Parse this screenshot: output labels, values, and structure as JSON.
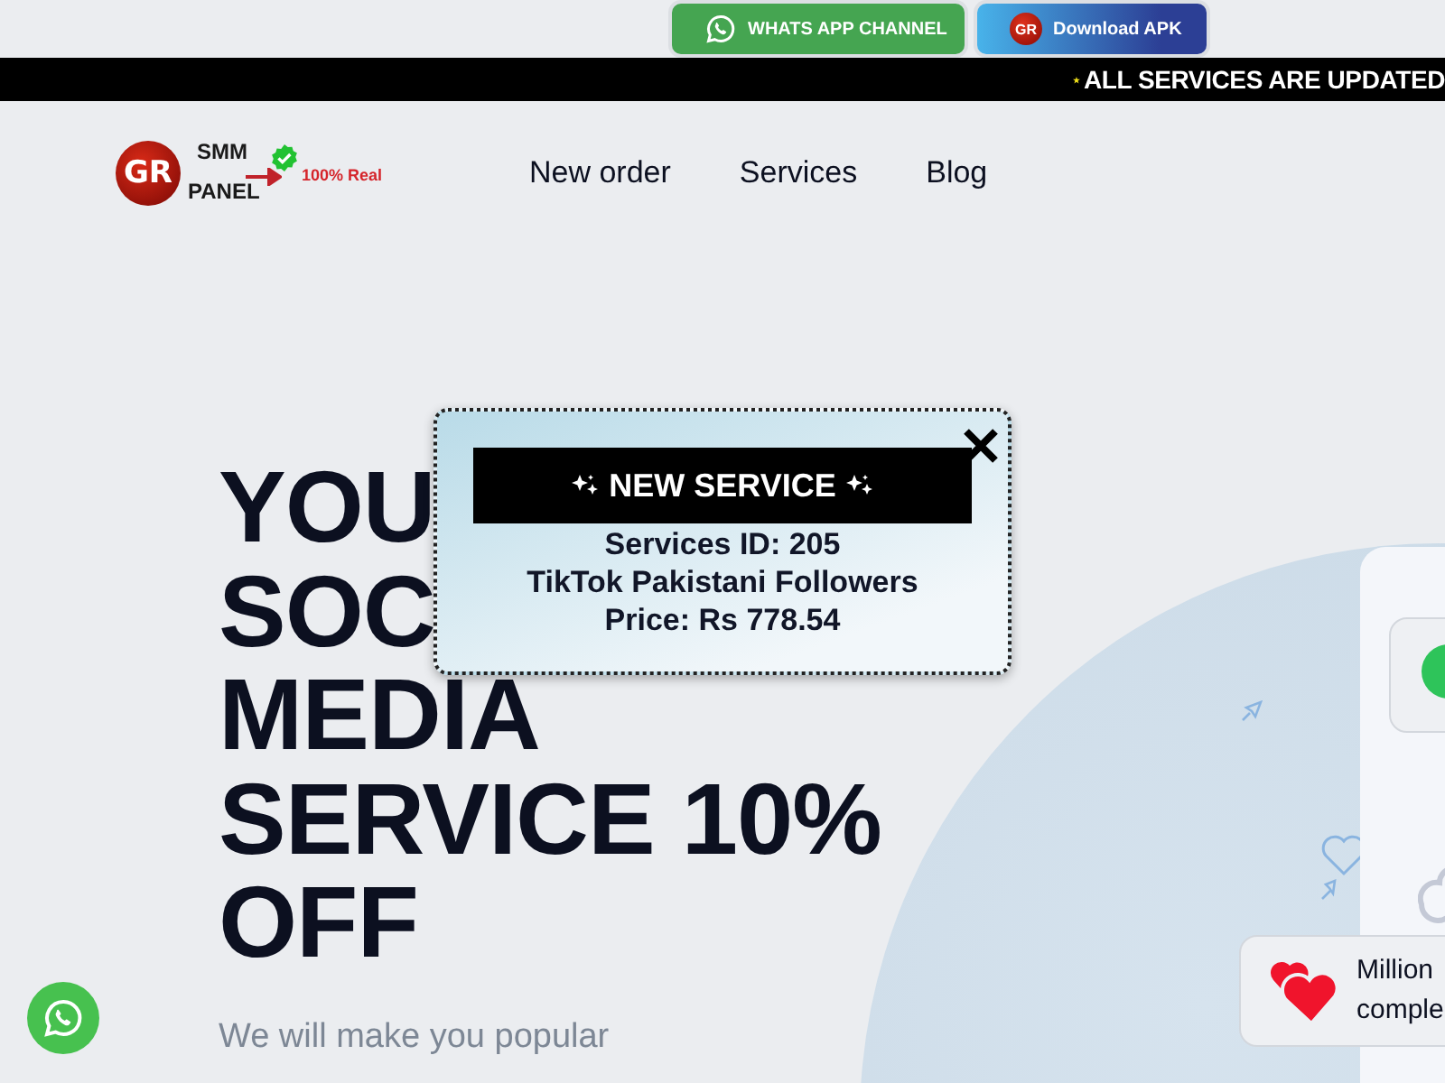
{
  "top_buttons": [
    {
      "kind": "whatsapp",
      "label": "WHATS APP CHANNEL"
    },
    {
      "kind": "apk",
      "badge": "GR",
      "label": "Download APK"
    }
  ],
  "ticker": {
    "text": "ALL SERVICES ARE UPDATED"
  },
  "logo": {
    "badge": "GR",
    "line_1": "SMM",
    "line_2": "PANEL",
    "tag": "100% Real"
  },
  "nav": [
    {
      "label": "New order"
    },
    {
      "label": "Services"
    },
    {
      "label": "Blog"
    }
  ],
  "hero": {
    "title_lines": [
      "YOU",
      "SOC",
      "MEDIA",
      "SERVICE 10%",
      "OFF"
    ],
    "subtitle": "We will make you popular"
  },
  "stats_card": {
    "lines": [
      "Million",
      "comple"
    ]
  },
  "popup": {
    "title": "NEW SERVICE",
    "lines": [
      "Services ID: 205",
      "TikTok Pakistani Followers",
      "Price: Rs 778.54"
    ]
  }
}
